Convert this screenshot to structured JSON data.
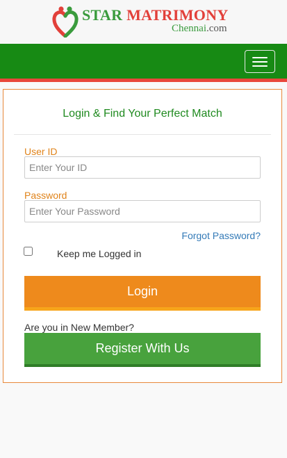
{
  "brand": {
    "title_part1": "STAR ",
    "title_part2": "MATRIMONY",
    "subtitle_part1": "Chennai",
    "subtitle_part2": ".com",
    "colors": {
      "green": "#3a9b3d",
      "red": "#e2403a",
      "navbar": "#178a14",
      "accent_orange": "#ee8a1c",
      "register_green": "#48a23d"
    }
  },
  "navbar": {
    "menu_icon": "hamburger-icon"
  },
  "login_card": {
    "heading": "Login & Find Your Perfect Match",
    "user_id_label": "User ID",
    "user_id_placeholder": "Enter Your ID",
    "user_id_value": "",
    "password_label": "Password",
    "password_placeholder": "Enter Your Password",
    "password_value": "",
    "forgot_password": "Forgot Password?",
    "remember_label": "Keep me Logged in",
    "remember_checked": false,
    "login_button": "Login",
    "new_member_prompt": "Are you in New Member?",
    "register_button": "Register With Us"
  }
}
